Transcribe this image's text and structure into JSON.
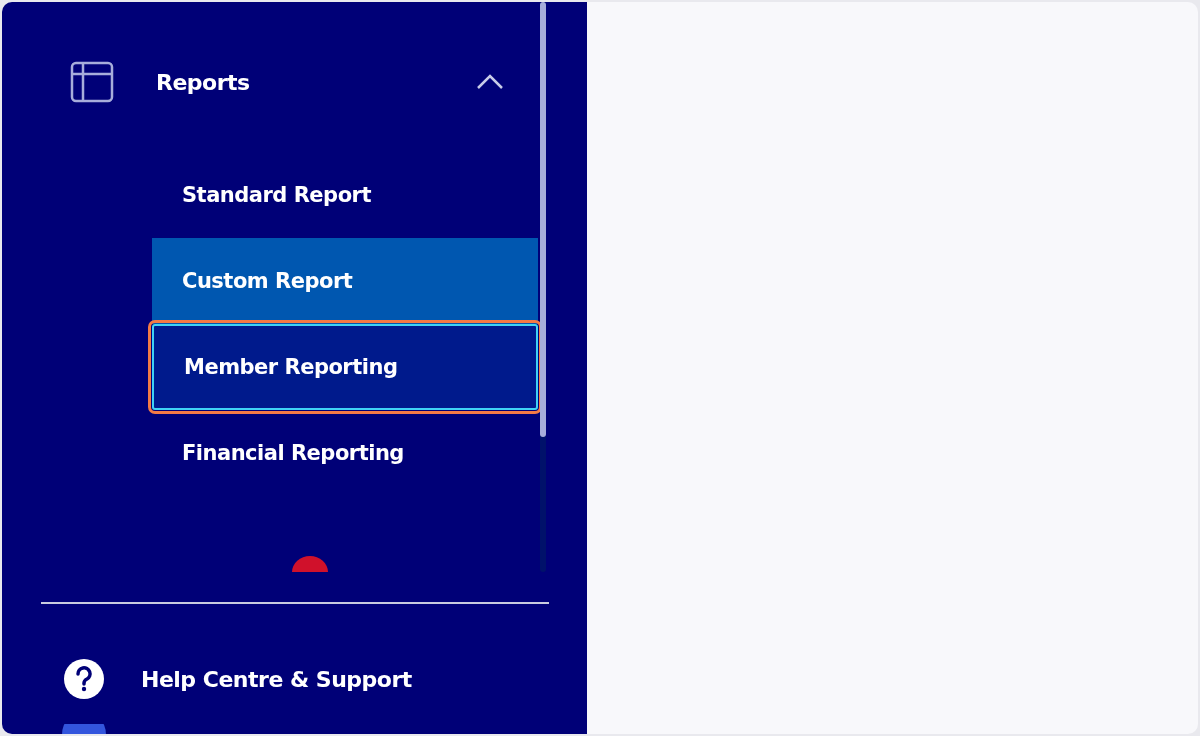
{
  "sidebar": {
    "section": {
      "label": "Reports",
      "expanded": true,
      "items": [
        {
          "label": "Standard Report",
          "selected": false,
          "focused": false
        },
        {
          "label": "Custom Report",
          "selected": true,
          "focused": false
        },
        {
          "label": "Member Reporting",
          "selected": false,
          "focused": true
        },
        {
          "label": "Financial Reporting",
          "selected": false,
          "focused": false
        }
      ]
    },
    "footer": {
      "label": "Help Centre & Support"
    }
  }
}
